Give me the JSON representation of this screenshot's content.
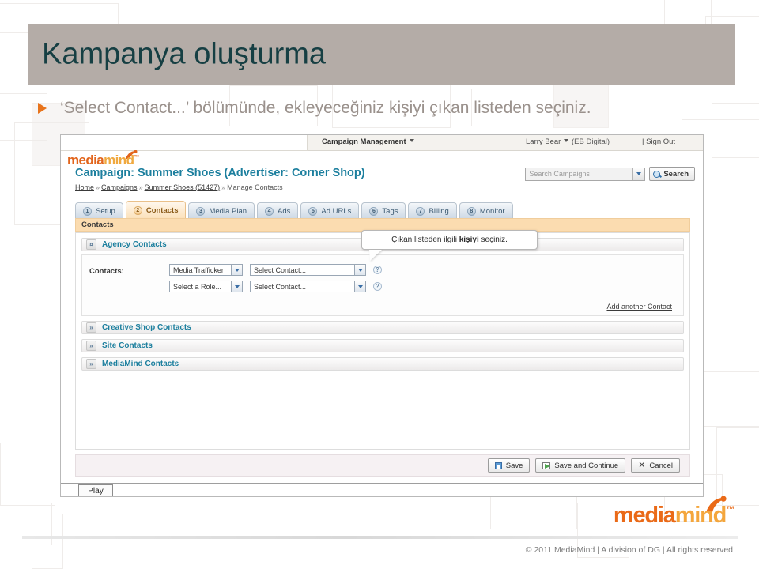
{
  "slide": {
    "title": "Kampanya oluşturma",
    "bullet": "‘Select Contact...’ bölümünde, ekleyeceğiniz kişiyi çıkan listeden seçiniz.",
    "title_bg": "#b4aca7",
    "title_color": "#163f43",
    "bullet_color": "#9a918c",
    "bullet_marker_color": "#e8741c"
  },
  "app": {
    "topbar": {
      "campaign_management": "Campaign Management",
      "user": "Larry Bear",
      "org": "(EB Digital)",
      "sign_out_sep": "|",
      "sign_out": "Sign Out"
    },
    "logo": {
      "part1": "media",
      "part2": "mind",
      "tm": "™"
    },
    "header": {
      "campaign_heading": "Campaign: Summer Shoes (Advertiser: Corner Shop)",
      "heading_color": "#1c7f9e"
    },
    "breadcrumb": {
      "items": [
        "Home",
        "Campaigns",
        "Summer Shoes (51427)",
        "Manage Contacts"
      ],
      "separator": "»"
    },
    "search": {
      "placeholder": "Search Campaigns",
      "button_label": "Search",
      "icon": "magnifier-icon"
    },
    "tabs": [
      {
        "num": "1",
        "label": "Setup",
        "active": false
      },
      {
        "num": "2",
        "label": "Contacts",
        "active": true
      },
      {
        "num": "3",
        "label": "Media Plan",
        "active": false
      },
      {
        "num": "4",
        "label": "Ads",
        "active": false
      },
      {
        "num": "5",
        "label": "Ad URLs",
        "active": false
      },
      {
        "num": "6",
        "label": "Tags",
        "active": false
      },
      {
        "num": "7",
        "label": "Billing",
        "active": false
      },
      {
        "num": "8",
        "label": "Monitor",
        "active": false
      }
    ],
    "band_label": "Contacts",
    "agency_section": {
      "title": "Agency Contacts",
      "toggle_icon": "chevron-collapse-icon",
      "toggle_glyph": "¤",
      "contacts_label": "Contacts:",
      "rows": [
        {
          "role": "Media Trafficker",
          "contact": "Select Contact...",
          "help": "?"
        },
        {
          "role": "Select a Role...",
          "contact": "Select Contact...",
          "help": "?"
        }
      ],
      "add_another": "Add another Contact"
    },
    "collapsed_sections": [
      {
        "title": "Creative Shop Contacts",
        "toggle_glyph": "»"
      },
      {
        "title": "Site Contacts",
        "toggle_glyph": "»"
      },
      {
        "title": "MediaMind Contacts",
        "toggle_glyph": "»"
      }
    ],
    "tooltip": {
      "prefix": "Çıkan listeden ilgili ",
      "emphasis": "kişiyi",
      "suffix": " seçiniz."
    },
    "actions": [
      {
        "label": "Save",
        "icon": "floppy-disk-icon"
      },
      {
        "label": "Save and Continue",
        "icon": "green-arrow-icon"
      },
      {
        "label": "Cancel",
        "icon": "close-x-icon"
      }
    ],
    "play_button": "Play"
  },
  "footer": {
    "logo_part1": "media",
    "logo_part2": "mind",
    "logo_tm": "™",
    "copyright": "© 2011 MediaMind | A division of DG | All rights reserved"
  }
}
